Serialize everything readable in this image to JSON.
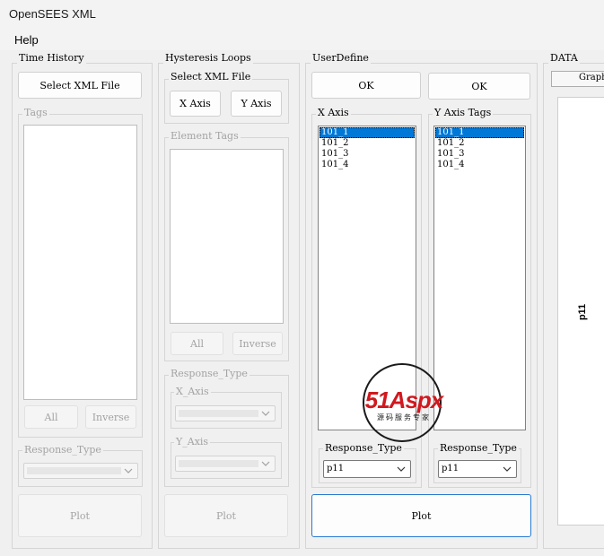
{
  "window": {
    "title": "OpenSEES XML"
  },
  "menu": {
    "help": "Help"
  },
  "time_history": {
    "title": "Time History",
    "select_button": "Select XML File",
    "tags_label": "Tags",
    "all_button": "All",
    "inverse_button": "Inverse",
    "response_type_label": "Response_Type",
    "plot_button": "Plot"
  },
  "hysteresis": {
    "title": "Hysteresis Loops",
    "select_label": "Select XML File",
    "x_axis_button": "X Axis",
    "y_axis_button": "Y Axis",
    "element_tags_label": "Element Tags",
    "all_button": "All",
    "inverse_button": "Inverse",
    "response_type_label": "Response_Type",
    "x_axis_label": "X_Axis",
    "y_axis_label": "Y_Axis",
    "plot_button": "Plot"
  },
  "user_define": {
    "title": "UserDefine",
    "ok_left": "OK",
    "ok_right": "OK",
    "x_axis_label": "X Axis",
    "y_axis_tags_label": "Y Axis Tags",
    "x_items": [
      "101_1",
      "101_2",
      "101_3",
      "101_4"
    ],
    "y_items": [
      "101_1",
      "101_2",
      "101_3",
      "101_4"
    ],
    "x_response_type_label": "Response_Type",
    "y_response_type_label": "Response_Type",
    "x_response_value": "p11",
    "y_response_value": "p11",
    "plot_button": "Plot"
  },
  "data_panel": {
    "title": "DATA",
    "tab_label": "Graph",
    "y_axis_label": "p11"
  },
  "watermark": {
    "text": "51Aspx",
    "subtitle": "源码服务专家"
  },
  "colors": {
    "selection": "#0078d7",
    "primary_border": "#2a7ad1",
    "watermark_red": "#d0191f",
    "watermark_green": "#3aa832"
  }
}
